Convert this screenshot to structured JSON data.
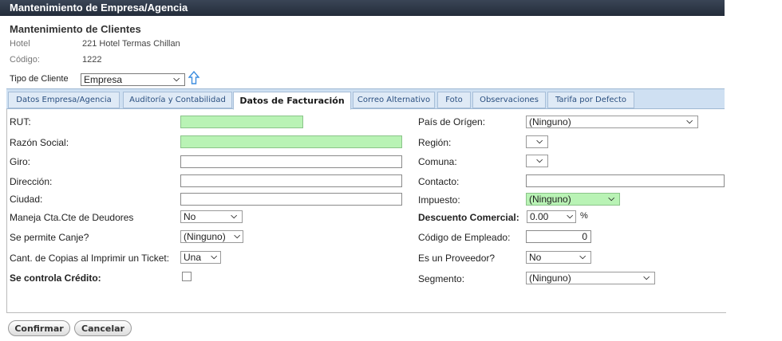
{
  "window_title": "Mantenimiento de Empresa/Agencia",
  "section_title": "Mantenimiento de Clientes",
  "info": {
    "hotel_label": "Hotel",
    "hotel_value": "221 Hotel Termas Chillan",
    "codigo_label": "Código:",
    "codigo_value": "1222"
  },
  "tipo_cliente": {
    "label": "Tipo de Cliente",
    "value": "Empresa"
  },
  "tabs": [
    "Datos Empresa/Agencia",
    "Auditoría y Contabilidad",
    "Datos de Facturación",
    "Correo Alternativo",
    "Foto",
    "Observaciones",
    "Tarifa por Defecto"
  ],
  "active_tab": "Datos de Facturación",
  "left_fields": {
    "rut": {
      "label": "RUT:",
      "value": ""
    },
    "razon_social": {
      "label": "Razón Social:",
      "value": ""
    },
    "giro": {
      "label": "Giro:",
      "value": ""
    },
    "direccion": {
      "label": "Dirección:",
      "value": ""
    },
    "ciudad": {
      "label": "Ciudad:",
      "value": ""
    },
    "maneja_cta": {
      "label": "Maneja Cta.Cte de Deudores",
      "value": "No"
    },
    "permite_canje": {
      "label": "Se permite Canje?",
      "value": "(Ninguno)"
    },
    "cant_copias": {
      "label": "Cant. de Copias al Imprimir un Ticket:",
      "value": "Una"
    },
    "controla_credito": {
      "label": "Se controla Crédito:",
      "checked": false
    }
  },
  "right_fields": {
    "pais_origen": {
      "label": "País de Orígen:",
      "value": "(Ninguno)"
    },
    "region": {
      "label": "Región:",
      "value": ""
    },
    "comuna": {
      "label": "Comuna:",
      "value": ""
    },
    "contacto": {
      "label": "Contacto:",
      "value": ""
    },
    "impuesto": {
      "label": "Impuesto:",
      "value": "(Ninguno)"
    },
    "descuento": {
      "label": "Descuento Comercial:",
      "value": "0.00",
      "unit": "%"
    },
    "codigo_empleado": {
      "label": "Código de Empleado:",
      "value": "0"
    },
    "es_proveedor": {
      "label": "Es un Proveedor?",
      "value": "No"
    },
    "segmento": {
      "label": "Segmento:",
      "value": "(Ninguno)"
    }
  },
  "buttons": {
    "confirm": "Confirmar",
    "cancel": "Cancelar"
  },
  "colors": {
    "required_field": "#b9f3b5",
    "titlebar": "#2b3444",
    "tab_bar": "#cfe0f2"
  },
  "icons": {
    "dropdown": "chevron-down-icon",
    "up": "up-arrow-icon"
  }
}
